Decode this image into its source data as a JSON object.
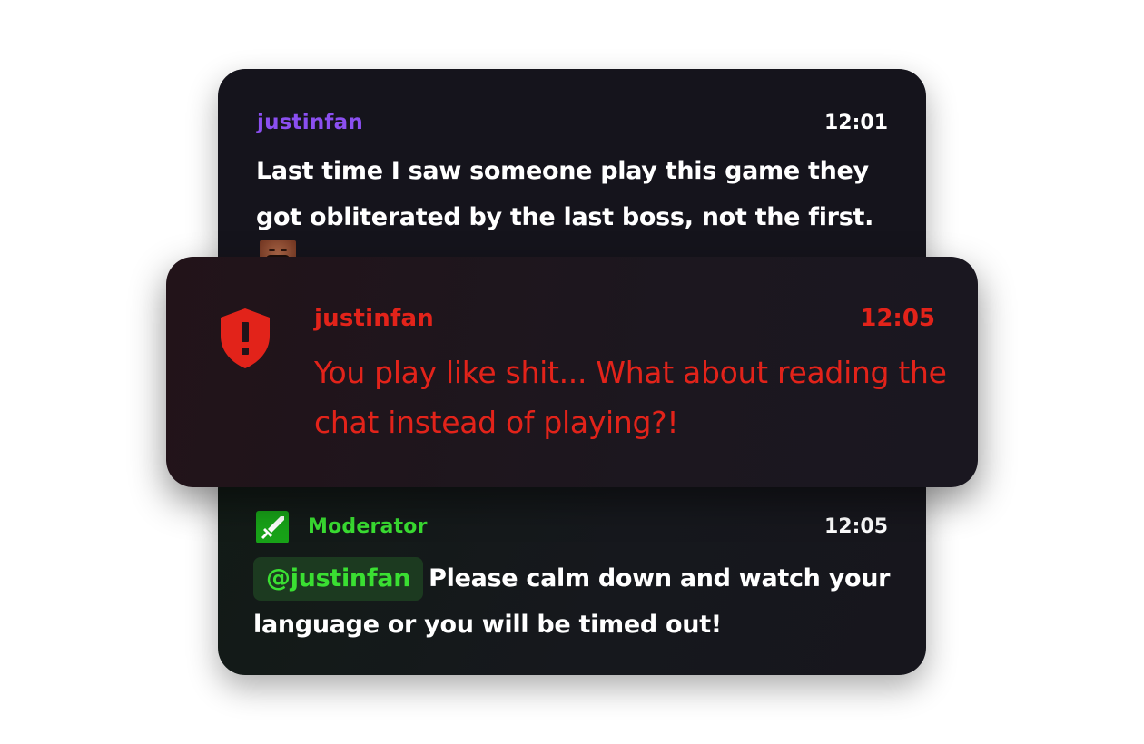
{
  "messages": [
    {
      "username": "justinfan",
      "time": "12:01",
      "text": "Last time I saw someone play this game they got obliterated by the last boss, not the first.",
      "emote": "laughing-man-emote"
    },
    {
      "username": "justinfan",
      "time": "12:05",
      "text": "You play like shit... What about reading the chat instead of playing?!",
      "icon": "shield-alert-icon"
    },
    {
      "username": "Moderator",
      "time": "12:05",
      "mention": "@justinfan",
      "text": "Please calm down and watch your language or you will be timed out!",
      "icon": "sword-icon"
    }
  ],
  "colors": {
    "username_default": "#8b4ff0",
    "flagged": "#e2231a",
    "moderator": "#3adf32",
    "moderator_badge": "#18a318",
    "card_background": "#15141c"
  }
}
